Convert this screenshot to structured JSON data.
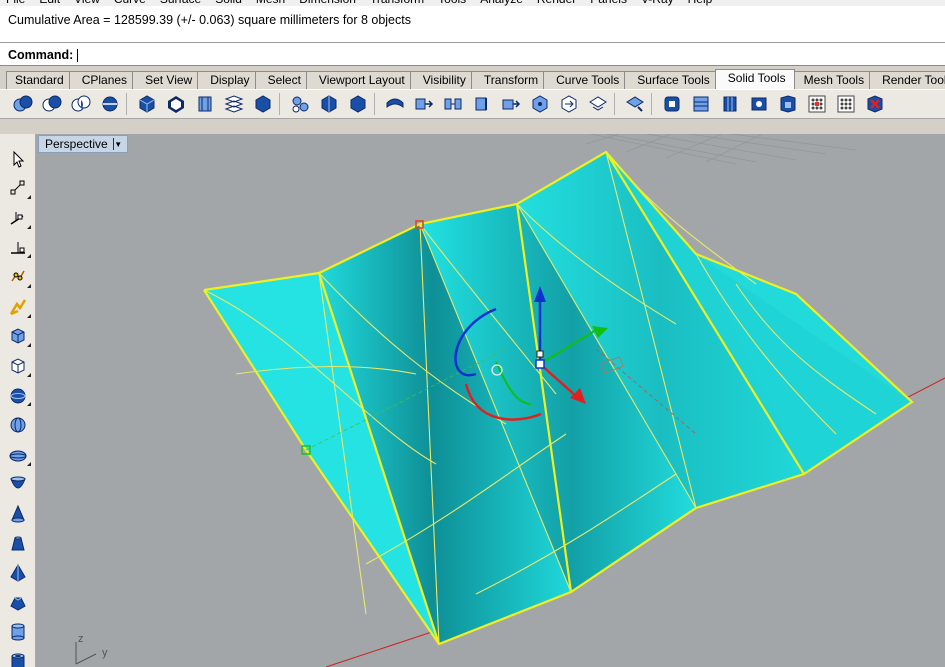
{
  "menu": [
    "File",
    "Edit",
    "View",
    "Curve",
    "Surface",
    "Solid",
    "Mesh",
    "Dimension",
    "Transform",
    "Tools",
    "Analyze",
    "Render",
    "Panels",
    "V-Ray",
    "Help"
  ],
  "history": {
    "line": "Cumulative Area = 128599.39 (+/- 0.063) square millimeters for 8 objects"
  },
  "command": {
    "label": "Command:",
    "value": ""
  },
  "tabs": [
    {
      "label": "Standard",
      "active": false
    },
    {
      "label": "CPlanes",
      "active": false
    },
    {
      "label": "Set View",
      "active": false
    },
    {
      "label": "Display",
      "active": false
    },
    {
      "label": "Select",
      "active": false
    },
    {
      "label": "Viewport Layout",
      "active": false
    },
    {
      "label": "Visibility",
      "active": false
    },
    {
      "label": "Transform",
      "active": false
    },
    {
      "label": "Curve Tools",
      "active": false
    },
    {
      "label": "Surface Tools",
      "active": false
    },
    {
      "label": "Solid Tools",
      "active": true
    },
    {
      "label": "Mesh Tools",
      "active": false
    },
    {
      "label": "Render Tools",
      "active": false
    }
  ],
  "toolbar_icons": [
    "boolean-union-icon",
    "boolean-difference-icon",
    "boolean-intersection-icon",
    "boolean-split-icon",
    "cap-planar-holes-icon",
    "extract-surface-icon",
    "merge-faces-icon",
    "fillet-edge-icon",
    "chamfer-edge-icon",
    "solid-edit-tools-icon",
    "offset-solid-icon",
    "shell-icon",
    "move-face-icon",
    "move-face-to-boundary-icon",
    "extrude-face-icon",
    "move-edge-icon",
    "split-face-icon",
    "fold-face-icon",
    "move-hole-icon",
    "rotate-hole-icon",
    "copy-hole-icon",
    "delete-hole-icon",
    "create-solid-icon",
    "history-record-icon",
    "wireframe-icon",
    "mesh-solid-icon",
    "check-object-icon",
    "select-bad-objects-icon",
    "delete-faces-icon"
  ],
  "left_tools": [
    {
      "name": "select-arrow-icon",
      "menu": false
    },
    {
      "name": "point-tools-icon",
      "menu": true
    },
    {
      "name": "line-tools-icon",
      "menu": true
    },
    {
      "name": "curve-from-objects-icon",
      "menu": true
    },
    {
      "name": "edit-points-icon",
      "menu": true
    },
    {
      "name": "transform-tools-icon",
      "menu": true
    },
    {
      "name": "solid-box-icon",
      "menu": true
    },
    {
      "name": "box-variations-icon",
      "menu": true
    },
    {
      "name": "sphere-icon",
      "menu": true
    },
    {
      "name": "sphere-variations-icon",
      "menu": false
    },
    {
      "name": "ellipsoid-icon",
      "menu": true
    },
    {
      "name": "paraboloid-icon",
      "menu": false
    },
    {
      "name": "cone-icon",
      "menu": false
    },
    {
      "name": "truncated-cone-icon",
      "menu": false
    },
    {
      "name": "pyramid-icon",
      "menu": false
    },
    {
      "name": "truncated-pyramid-icon",
      "menu": false
    },
    {
      "name": "cylinder-icon",
      "menu": false
    },
    {
      "name": "tube-icon",
      "menu": false
    }
  ],
  "viewport": {
    "title": "Perspective",
    "axis_z": "z",
    "axis_y": "y"
  },
  "colors": {
    "surface": "#22e6e6",
    "edge_highlight": "#f0f020",
    "background": "#a2a6a8",
    "gumball_x": "#e02020",
    "gumball_y": "#10c010",
    "gumball_z": "#1030d0"
  }
}
